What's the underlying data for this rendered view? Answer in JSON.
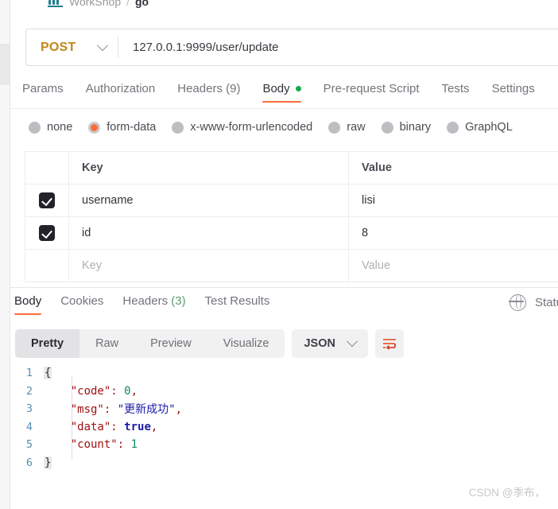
{
  "breadcrumb": {
    "icon": "collection-icon",
    "workspace": "WorkShop",
    "separator": "/",
    "current": "go"
  },
  "request_bar": {
    "method": "POST",
    "method_caret": "chevron-down-icon",
    "url": "127.0.0.1:9999/user/update"
  },
  "request_tabs": [
    {
      "label": "Params",
      "active": false,
      "dot": false
    },
    {
      "label": "Authorization",
      "active": false,
      "dot": false
    },
    {
      "label": "Headers (9)",
      "active": false,
      "dot": false
    },
    {
      "label": "Body",
      "active": true,
      "dot": true
    },
    {
      "label": "Pre-request Script",
      "active": false,
      "dot": false
    },
    {
      "label": "Tests",
      "active": false,
      "dot": false
    },
    {
      "label": "Settings",
      "active": false,
      "dot": false
    }
  ],
  "body_types": [
    {
      "label": "none",
      "selected": false
    },
    {
      "label": "form-data",
      "selected": true
    },
    {
      "label": "x-www-form-urlencoded",
      "selected": false
    },
    {
      "label": "raw",
      "selected": false
    },
    {
      "label": "binary",
      "selected": false
    },
    {
      "label": "GraphQL",
      "selected": false
    }
  ],
  "form_table": {
    "headers": {
      "key": "Key",
      "value": "Value"
    },
    "rows": [
      {
        "checked": true,
        "key": "username",
        "value": "lisi"
      },
      {
        "checked": true,
        "key": "id",
        "value": "8"
      }
    ],
    "placeholder_row": {
      "key": "Key",
      "value": "Value"
    }
  },
  "response_tabs": [
    {
      "label": "Body",
      "active": true
    },
    {
      "label": "Cookies",
      "active": false
    },
    {
      "label": "Headers",
      "count": "(3)",
      "active": false
    },
    {
      "label": "Test Results",
      "active": false
    }
  ],
  "response_status": {
    "icon": "globe-icon",
    "text": "Statu"
  },
  "view_toolbar": {
    "modes": [
      {
        "label": "Pretty",
        "active": true
      },
      {
        "label": "Raw",
        "active": false
      },
      {
        "label": "Preview",
        "active": false
      },
      {
        "label": "Visualize",
        "active": false
      }
    ],
    "format": "JSON",
    "format_caret": "chevron-down-icon",
    "wrap_icon": "word-wrap-icon"
  },
  "response_body": {
    "language": "json",
    "lines": [
      {
        "n": "1",
        "tokens": [
          {
            "t": "{",
            "c": "brace"
          }
        ]
      },
      {
        "n": "2",
        "tokens": [
          {
            "t": "    ",
            "c": "plain"
          },
          {
            "t": "\"code\"",
            "c": "jkey"
          },
          {
            "t": ": ",
            "c": "jpunc"
          },
          {
            "t": "0",
            "c": "jnum"
          },
          {
            "t": ",",
            "c": "jpunc"
          }
        ]
      },
      {
        "n": "3",
        "tokens": [
          {
            "t": "    ",
            "c": "plain"
          },
          {
            "t": "\"msg\"",
            "c": "jkey"
          },
          {
            "t": ": ",
            "c": "jpunc"
          },
          {
            "t": "\"更新成功\"",
            "c": "jstr"
          },
          {
            "t": ",",
            "c": "jpunc"
          }
        ]
      },
      {
        "n": "4",
        "tokens": [
          {
            "t": "    ",
            "c": "plain"
          },
          {
            "t": "\"data\"",
            "c": "jkey"
          },
          {
            "t": ": ",
            "c": "jpunc"
          },
          {
            "t": "true",
            "c": "jbool"
          },
          {
            "t": ",",
            "c": "jpunc"
          }
        ]
      },
      {
        "n": "5",
        "tokens": [
          {
            "t": "    ",
            "c": "plain"
          },
          {
            "t": "\"count\"",
            "c": "jkey"
          },
          {
            "t": ": ",
            "c": "jpunc"
          },
          {
            "t": "1",
            "c": "jnum"
          }
        ]
      },
      {
        "n": "6",
        "tokens": [
          {
            "t": "}",
            "c": "brace"
          }
        ]
      }
    ]
  },
  "watermark": "CSDN @季布，",
  "colors": {
    "accent": "#ff6c37",
    "method": "#c2871a",
    "green_dot": "#10ad4a",
    "json_key": "#a01010",
    "json_number": "#0e8a62",
    "json_string": "#1b1ba8",
    "checkbox": "#22222a"
  }
}
